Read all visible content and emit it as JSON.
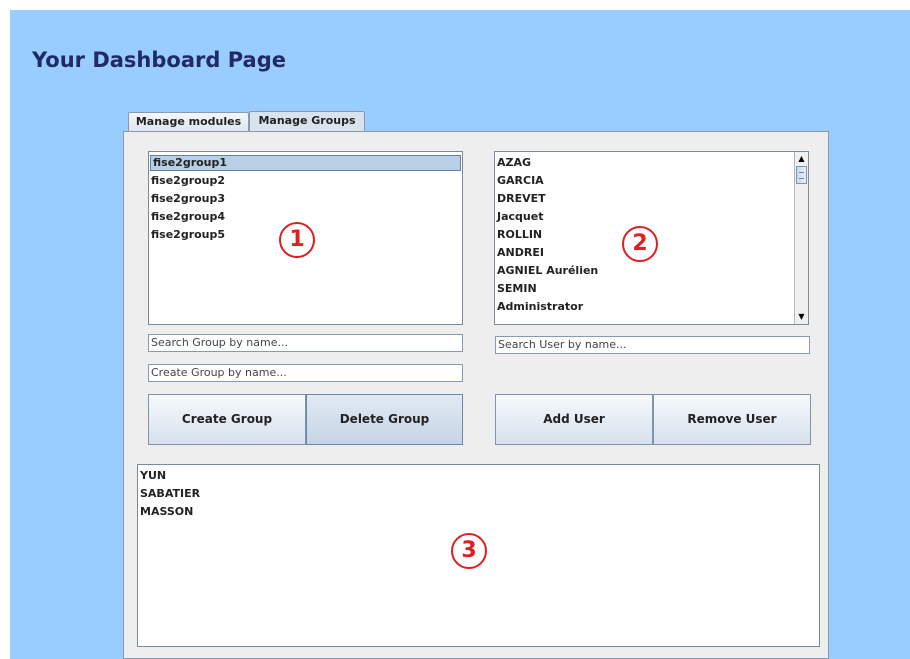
{
  "page": {
    "title": "Your Dashboard Page"
  },
  "tabs": [
    {
      "label": "Manage modules",
      "selected": false
    },
    {
      "label": "Manage Groups",
      "selected": true
    }
  ],
  "groups_list": {
    "items": [
      "fise2group1",
      "fise2group2",
      "fise2group3",
      "fise2group4",
      "fise2group5"
    ],
    "selected_index": 0
  },
  "users_list": {
    "items": [
      "AZAG",
      "GARCIA",
      "DREVET",
      "Jacquet",
      "ROLLIN",
      "ANDREI",
      "AGNIEL Aurélien",
      "SEMIN",
      "Administrator"
    ]
  },
  "group_members_list": {
    "items": [
      "YUN",
      "SABATIER",
      "MASSON"
    ]
  },
  "inputs": {
    "search_group_placeholder": "Search Group by name...",
    "create_group_placeholder": "Create Group by name...",
    "search_user_placeholder": "Search User by name..."
  },
  "buttons": {
    "create_group": "Create Group",
    "delete_group": "Delete Group",
    "add_user": "Add User",
    "remove_user": "Remove User"
  },
  "markers": [
    "1",
    "2",
    "3"
  ],
  "colors": {
    "background": "#99ccff",
    "title": "#1f2a66",
    "marker": "#e02020"
  }
}
